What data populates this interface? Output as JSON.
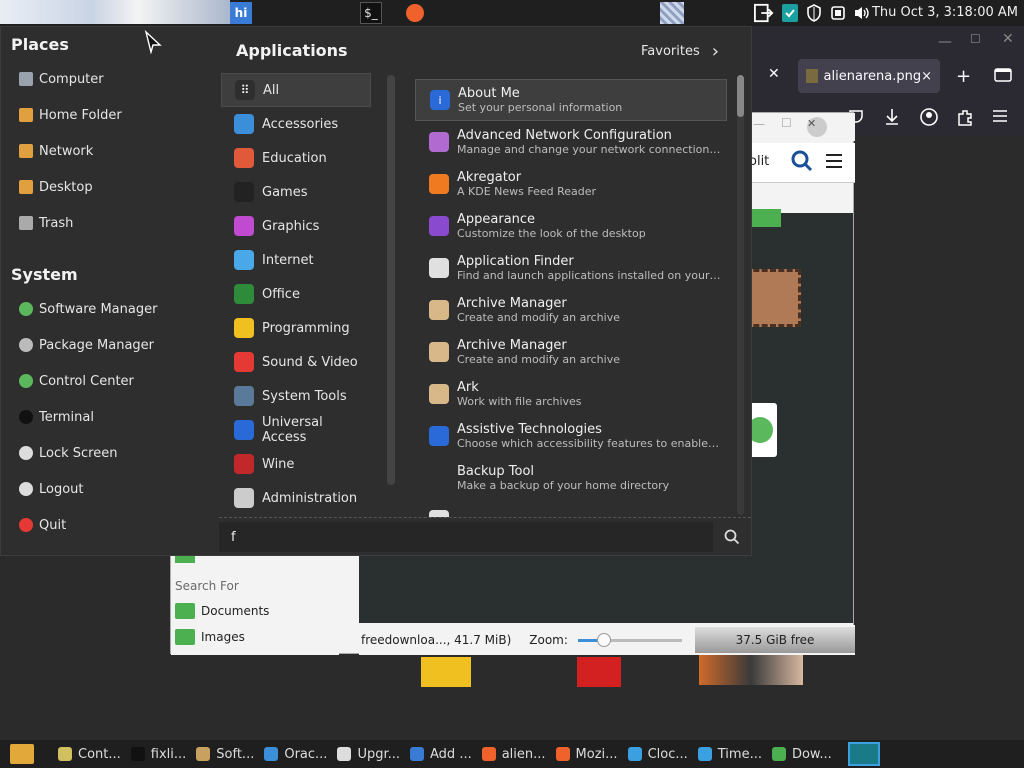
{
  "top_panel": {
    "tray_hi_label": "hi",
    "clock": "Thu Oct  3,  3:18:00 AM"
  },
  "browser": {
    "tab_title": "alienarena.png",
    "close_glyph": "×"
  },
  "file_manager": {
    "search_partial": "olit",
    "sidebar_header": "Search For",
    "sidebar_items": [
      "Documents",
      "Images"
    ],
    "status_text": "freedownloa..., 41.7 MiB)",
    "zoom_label": "Zoom:",
    "zoom_level": 0.25,
    "free_space": "37.5 GiB free"
  },
  "menu": {
    "places_title": "Places",
    "places": [
      {
        "label": "Computer",
        "icon": "computer-icon",
        "color": "#9aa3ad"
      },
      {
        "label": "Home Folder",
        "icon": "home-folder-icon",
        "color": "#e0a040"
      },
      {
        "label": "Network",
        "icon": "network-folder-icon",
        "color": "#e0a040"
      },
      {
        "label": "Desktop",
        "icon": "desktop-folder-icon",
        "color": "#e0a040"
      },
      {
        "label": "Trash",
        "icon": "trash-icon",
        "color": "#aaaaaa"
      }
    ],
    "system_title": "System",
    "system": [
      {
        "label": "Software Manager",
        "icon": "software-manager-icon",
        "color": "#5cb85c"
      },
      {
        "label": "Package Manager",
        "icon": "package-manager-icon",
        "color": "#bbbbbb"
      },
      {
        "label": "Control Center",
        "icon": "control-center-icon",
        "color": "#5cb85c"
      },
      {
        "label": "Terminal",
        "icon": "terminal-icon",
        "color": "#111111"
      },
      {
        "label": "Lock Screen",
        "icon": "lock-icon",
        "color": "#dddddd"
      },
      {
        "label": "Logout",
        "icon": "logout-icon",
        "color": "#dddddd"
      },
      {
        "label": "Quit",
        "icon": "power-icon",
        "color": "#e53935"
      }
    ],
    "applications_title": "Applications",
    "favorites_label": "Favorites",
    "categories": [
      {
        "label": "All",
        "icon": "grid-icon",
        "color": "#2e2e2e",
        "selected": true
      },
      {
        "label": "Accessories",
        "icon": "accessories-icon",
        "color": "#3a8fd8"
      },
      {
        "label": "Education",
        "icon": "education-icon",
        "color": "#e05a3a"
      },
      {
        "label": "Games",
        "icon": "games-icon",
        "color": "#222222"
      },
      {
        "label": "Graphics",
        "icon": "graphics-icon",
        "color": "#c04bd0"
      },
      {
        "label": "Internet",
        "icon": "internet-icon",
        "color": "#4aa8e8"
      },
      {
        "label": "Office",
        "icon": "office-icon",
        "color": "#2e8b3a"
      },
      {
        "label": "Programming",
        "icon": "programming-icon",
        "color": "#f0c020"
      },
      {
        "label": "Sound & Video",
        "icon": "sound-video-icon",
        "color": "#e53935"
      },
      {
        "label": "System Tools",
        "icon": "system-tools-icon",
        "color": "#5a7a9a"
      },
      {
        "label": "Universal Access",
        "icon": "universal-access-icon",
        "color": "#2a6ad8"
      },
      {
        "label": "Wine",
        "icon": "wine-icon",
        "color": "#c0282a"
      },
      {
        "label": "Administration",
        "icon": "administration-icon",
        "color": "#cccccc"
      }
    ],
    "apps": [
      {
        "name": "About Me",
        "desc": "Set your personal information",
        "icon": "info-icon",
        "color": "#2a6ad8",
        "selected": true
      },
      {
        "name": "Advanced Network Configuration",
        "desc": "Manage and change your network connection sett…",
        "icon": "network-config-icon",
        "color": "#b06ad0"
      },
      {
        "name": "Akregator",
        "desc": "A KDE News Feed Reader",
        "icon": "rss-icon",
        "color": "#f07a20"
      },
      {
        "name": "Appearance",
        "desc": "Customize the look of the desktop",
        "icon": "appearance-icon",
        "color": "#8a4ad0"
      },
      {
        "name": "Application Finder",
        "desc": "Find and launch applications installed on your sys…",
        "icon": "magnifier-icon",
        "color": "#e0e0e0"
      },
      {
        "name": "Archive Manager",
        "desc": "Create and modify an archive",
        "icon": "archive-icon",
        "color": "#d8b888"
      },
      {
        "name": "Archive Manager",
        "desc": "Create and modify an archive",
        "icon": "archive-icon",
        "color": "#d8b888"
      },
      {
        "name": "Ark",
        "desc": "Work with file archives",
        "icon": "ark-icon",
        "color": "#d8b888"
      },
      {
        "name": "Assistive Technologies",
        "desc": "Choose which accessibility features to enable wh…",
        "icon": "accessibility-icon",
        "color": "#2a6ad8"
      },
      {
        "name": "Backup Tool",
        "desc": "Make a backup of your home directory",
        "icon": "backup-icon",
        "color": "#2e2e2e"
      },
      {
        "name": "",
        "desc": "",
        "icon": "partial-icon",
        "color": "#e0e0e0"
      }
    ],
    "search_value": "f"
  },
  "taskbar": {
    "items": [
      {
        "label": "Cont...",
        "icon": "control-center-icon",
        "color": "#d0c060"
      },
      {
        "label": "fixli...",
        "icon": "terminal-icon",
        "color": "#111111"
      },
      {
        "label": "Soft...",
        "icon": "software-icon",
        "color": "#c8a060"
      },
      {
        "label": "Orac...",
        "icon": "virtualbox-icon",
        "color": "#3a8fd8"
      },
      {
        "label": "Upgr...",
        "icon": "shield-icon",
        "color": "#dddddd"
      },
      {
        "label": "Add ...",
        "icon": "window-icon",
        "color": "#3a7bd5"
      },
      {
        "label": "alien...",
        "icon": "firefox-icon",
        "color": "#f0622c"
      },
      {
        "label": "Mozi...",
        "icon": "firefox-icon",
        "color": "#f0622c"
      },
      {
        "label": "Cloc...",
        "icon": "clock-icon",
        "color": "#3aa0e0"
      },
      {
        "label": "Time...",
        "icon": "timeshift-icon",
        "color": "#3aa0e0"
      },
      {
        "label": "Dow...",
        "icon": "folder-icon",
        "color": "#4caf50"
      }
    ]
  }
}
